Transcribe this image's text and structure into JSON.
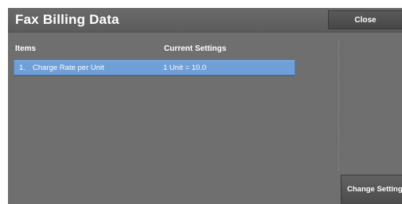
{
  "header": {
    "title": "Fax Billing Data",
    "close_label": "Close"
  },
  "columns": {
    "items": "Items",
    "current_settings": "Current Settings"
  },
  "rows": [
    {
      "number": "1.",
      "item": "Charge Rate per Unit",
      "value": "1 Unit = 10.0",
      "selected": true
    }
  ],
  "actions": {
    "change_settings_label": "Change Settings"
  },
  "colors": {
    "panel_background": "#6f6f6f",
    "selected_row": "#6f9fd6",
    "button": "#4c4c4c",
    "text": "#ffffff"
  }
}
